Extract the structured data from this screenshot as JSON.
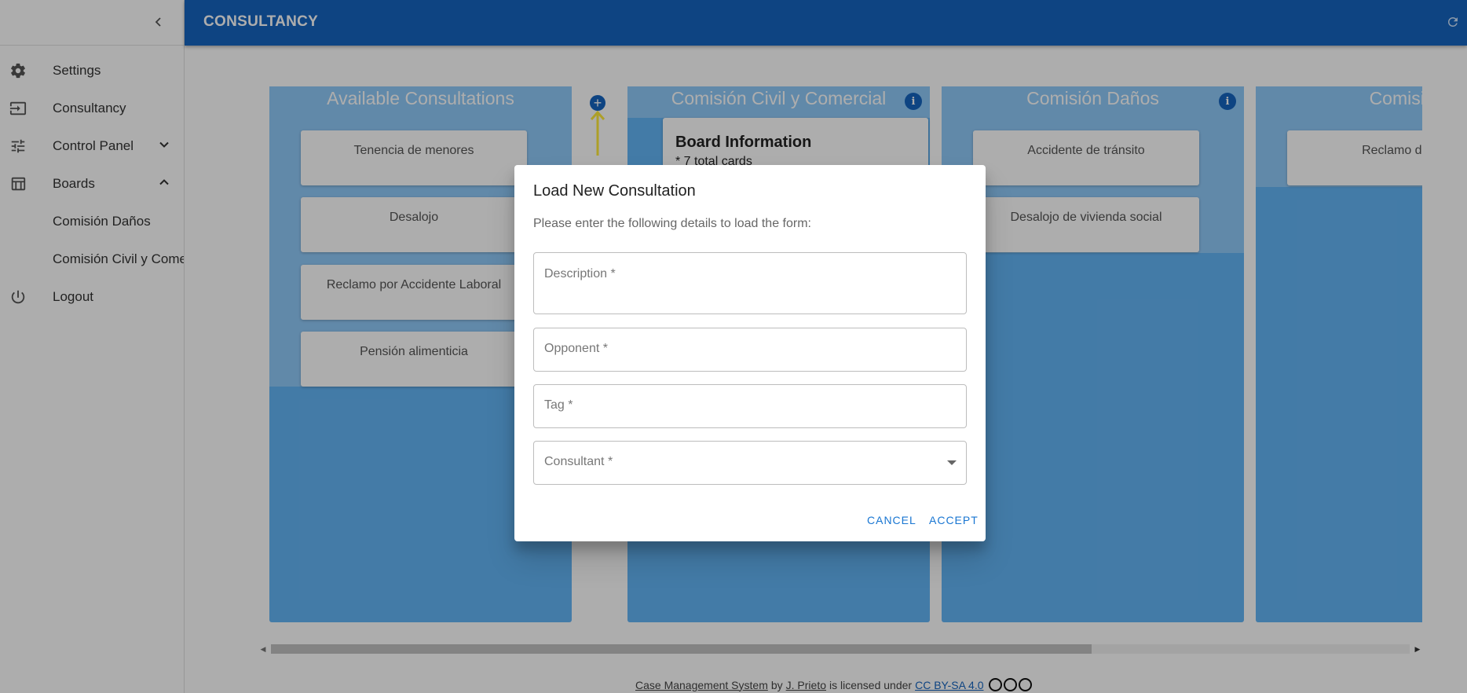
{
  "sidebar": {
    "items": [
      {
        "label": "Settings",
        "icon": "gear-icon"
      },
      {
        "label": "Consultancy",
        "icon": "login-icon"
      },
      {
        "label": "Control Panel",
        "icon": "tune-icon"
      },
      {
        "label": "Boards",
        "icon": "table-icon"
      }
    ],
    "boards": [
      "Comisión Daños",
      "Comisión Civil y Comer"
    ],
    "logout": "Logout"
  },
  "header": {
    "title": "CONSULTANCY"
  },
  "columns": {
    "available": {
      "title": "Available Consultations",
      "cards": [
        "Tenencia de menores",
        "Desalojo",
        "Reclamo por Accidente Laboral",
        "Pensión alimenticia"
      ]
    },
    "civil": {
      "title": "Comisión Civil y Comercial",
      "board_info_title": "Board Information",
      "board_info_count": "* 7 total cards"
    },
    "danos": {
      "title": "Comisión Daños",
      "cards": [
        "Accidente de tránsito",
        "Desalojo de vivienda social"
      ]
    },
    "partial": {
      "title": "Comisión",
      "cards": [
        "Reclamo de c"
      ]
    }
  },
  "footer": {
    "project": "Case Management System",
    "by": "by",
    "author": "J. Prieto",
    "licensed": "is licensed under",
    "license": "CC BY-SA 4.0"
  },
  "dialog": {
    "title": "Load New Consultation",
    "text": "Please enter the following details to load the form:",
    "fields": {
      "description": "Description *",
      "opponent": "Opponent *",
      "tag": "Tag *",
      "consultant": "Consultant *"
    },
    "cancel": "CANCEL",
    "accept": "ACCEPT"
  },
  "colors": {
    "header": "#1565c0",
    "column": "#64b5f6",
    "column_top": "#90caf9",
    "accent": "#1976d2",
    "arrow": "#ffeb3b"
  }
}
